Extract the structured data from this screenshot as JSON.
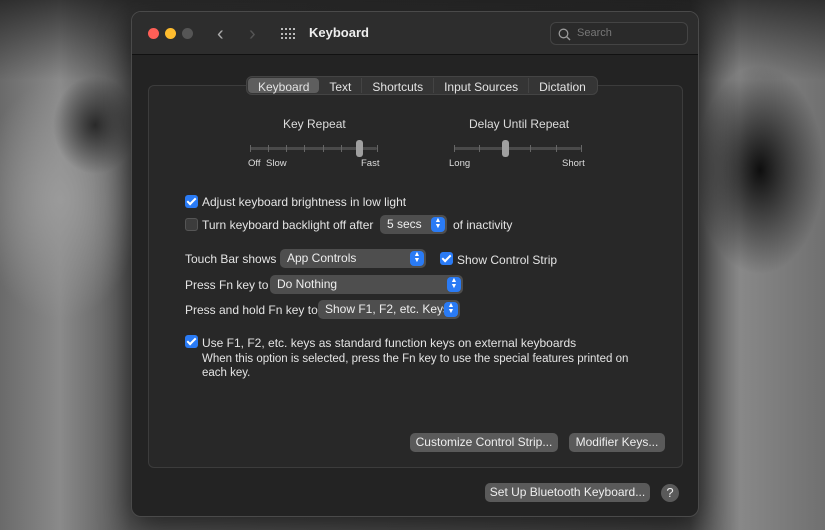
{
  "window": {
    "title": "Keyboard",
    "search_placeholder": "Search"
  },
  "tabs": [
    {
      "label": "Keyboard",
      "selected": true
    },
    {
      "label": "Text"
    },
    {
      "label": "Shortcuts"
    },
    {
      "label": "Input Sources"
    },
    {
      "label": "Dictation"
    }
  ],
  "key_repeat": {
    "label": "Key Repeat",
    "min_label": "Off",
    "slow_label": "Slow",
    "max_label": "Fast",
    "value_step": 6,
    "steps": 8
  },
  "delay_until_repeat": {
    "label": "Delay Until Repeat",
    "min_label": "Long",
    "max_label": "Short",
    "value_step": 2,
    "steps": 6
  },
  "options": {
    "adjust_brightness": {
      "label": "Adjust keyboard brightness in low light",
      "checked": true
    },
    "backlight_off": {
      "label": "Turn keyboard backlight off after",
      "checked": false,
      "value": "5 secs",
      "suffix": "of inactivity"
    },
    "touch_bar": {
      "label": "Touch Bar shows",
      "value": "App Controls"
    },
    "show_control_strip": {
      "label": "Show Control Strip",
      "checked": true
    },
    "press_fn": {
      "label": "Press Fn key to",
      "value": "Do Nothing"
    },
    "hold_fn": {
      "label": "Press and hold Fn key to",
      "value": "Show F1, F2, etc. Keys"
    },
    "use_f_keys": {
      "label": "Use F1, F2, etc. keys as standard function keys on external keyboards",
      "checked": true,
      "description_line1": "When this option is selected, press the Fn key to use the special features printed on",
      "description_line2": "each key."
    }
  },
  "buttons": {
    "customize": "Customize Control Strip...",
    "modifier": "Modifier Keys...",
    "bluetooth": "Set Up Bluetooth Keyboard...",
    "help": "?"
  },
  "colors": {
    "accent": "#2a7bf5",
    "close": "#fe5f57",
    "minimize": "#febc2e",
    "zoom_disabled": "#555555"
  }
}
